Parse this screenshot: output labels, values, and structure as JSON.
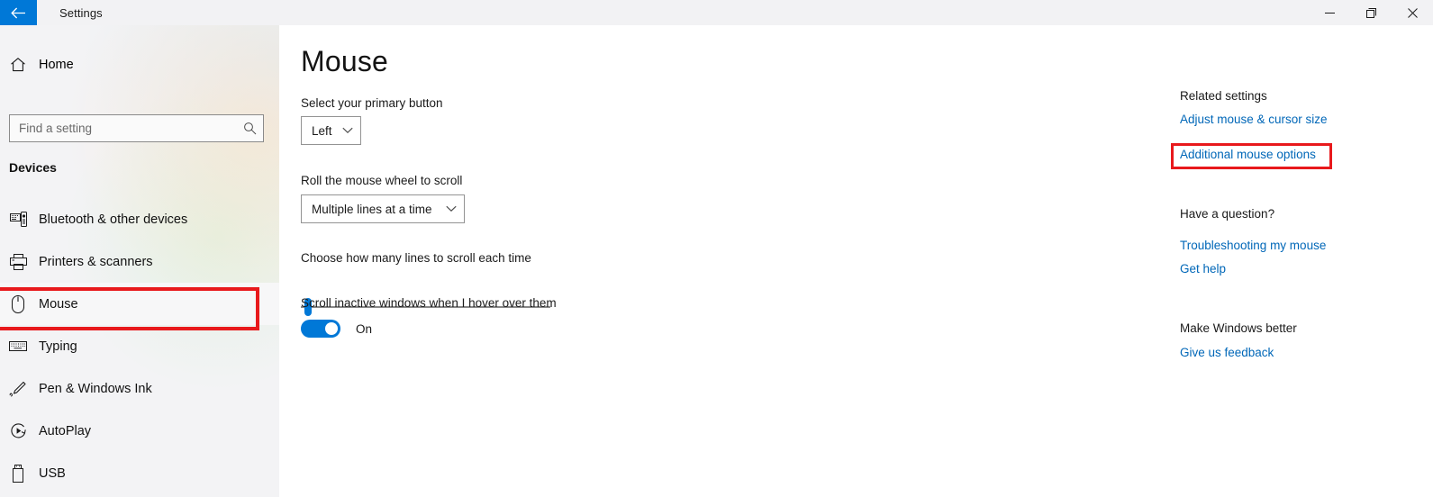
{
  "window": {
    "title": "Settings",
    "back_icon": "back-arrow-icon",
    "controls": {
      "minimize": "minimize-icon",
      "restore": "restore-icon",
      "close": "close-icon"
    }
  },
  "sidebar": {
    "home": {
      "label": "Home",
      "icon": "home-icon"
    },
    "search": {
      "placeholder": "Find a setting",
      "value": "",
      "icon": "search-icon"
    },
    "group_header": "Devices",
    "items": [
      {
        "label": "Bluetooth & other devices",
        "icon": "bluetooth-devices-icon",
        "selected": false
      },
      {
        "label": "Printers & scanners",
        "icon": "printer-icon",
        "selected": false
      },
      {
        "label": "Mouse",
        "icon": "mouse-icon",
        "selected": true
      },
      {
        "label": "Typing",
        "icon": "keyboard-icon",
        "selected": false
      },
      {
        "label": "Pen & Windows Ink",
        "icon": "pen-icon",
        "selected": false
      },
      {
        "label": "AutoPlay",
        "icon": "autoplay-icon",
        "selected": false
      },
      {
        "label": "USB",
        "icon": "usb-icon",
        "selected": false
      }
    ]
  },
  "main": {
    "page_title": "Mouse",
    "primary_button": {
      "label": "Select your primary button",
      "value": "Left"
    },
    "wheel_scroll": {
      "label": "Roll the mouse wheel to scroll",
      "value": "Multiple lines at a time"
    },
    "lines_slider": {
      "label": "Choose how many lines to scroll each time",
      "value": 1,
      "min": 1,
      "max": 100
    },
    "inactive_scroll": {
      "label": "Scroll inactive windows when I hover over them",
      "state": "On"
    }
  },
  "rail": {
    "related_settings_header": "Related settings",
    "adjust_link": "Adjust mouse & cursor size",
    "additional_options_link": "Additional mouse options",
    "question_header": "Have a question?",
    "troubleshooting_link": "Troubleshooting my mouse",
    "get_help_link": "Get help",
    "better_header": "Make Windows better",
    "feedback_link": "Give us feedback"
  },
  "annotations": {
    "highlight_color": "#e8191c",
    "boxes": [
      "sidebar-item-mouse",
      "additional-mouse-options-link"
    ]
  },
  "colors": {
    "accent": "#0078d7",
    "link": "#0067b8",
    "sidebar_bg": "#f3f3f5",
    "titlebar_bg": "#f2f2f4"
  }
}
